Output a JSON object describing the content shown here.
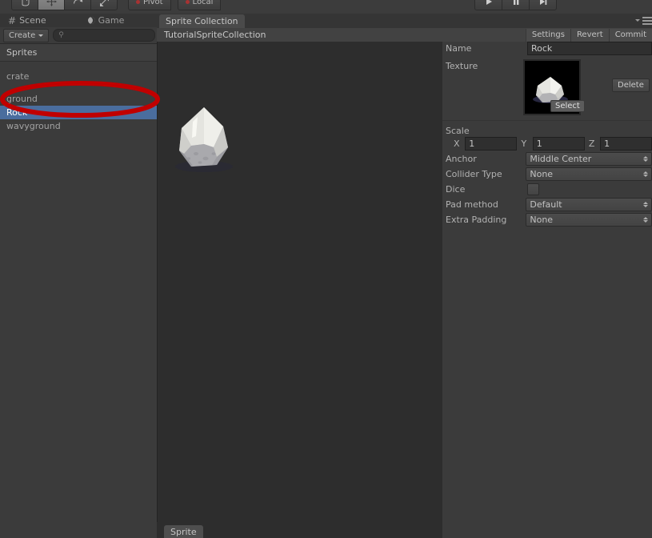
{
  "toolbar": {
    "tools": [
      {
        "name": "hand-tool",
        "active": false
      },
      {
        "name": "move-tool",
        "active": true
      },
      {
        "name": "rotate-tool",
        "active": false
      },
      {
        "name": "scale-tool",
        "active": false
      }
    ],
    "pivot_label": "Pivot",
    "local_label": "Local",
    "play_label": "play-icon",
    "pause_label": "pause-icon",
    "step_label": "step-icon"
  },
  "left_dock": {
    "tabs": [
      {
        "label": "Scene",
        "icon": "grid-icon"
      },
      {
        "label": "Game",
        "icon": "moon-icon"
      }
    ],
    "create_label": "Create",
    "search_value": "",
    "search_placeholder": "",
    "list_header": "Sprites",
    "items": [
      {
        "label": "crate",
        "selected": false
      },
      {
        "label": "ground",
        "selected": false
      },
      {
        "label": "Rock",
        "selected": true
      },
      {
        "label": "wavyground",
        "selected": false
      }
    ]
  },
  "center": {
    "tab_label": "Sprite Collection",
    "title": "TutorialSpriteCollection",
    "bottom_tab": "Sprite"
  },
  "inspector": {
    "menu_icon": "options-menu-icon",
    "actions": [
      "Settings",
      "Revert",
      "Commit"
    ],
    "name_label": "Name",
    "name_value": "Rock",
    "texture_label": "Texture",
    "select_label": "Select",
    "delete_label": "Delete",
    "scale_label": "Scale",
    "scale": {
      "x_label": "X",
      "x_value": "1",
      "y_label": "Y",
      "y_value": "1",
      "z_label": "Z",
      "z_value": "1"
    },
    "fields": [
      {
        "label": "Anchor",
        "value": "Middle Center",
        "type": "dropdown"
      },
      {
        "label": "Collider Type",
        "value": "None",
        "type": "dropdown"
      },
      {
        "label": "Dice",
        "value": "",
        "type": "checkbox"
      },
      {
        "label": "Pad method",
        "value": "Default",
        "type": "dropdown"
      },
      {
        "label": "Extra Padding",
        "value": "None",
        "type": "dropdown"
      }
    ]
  },
  "annotation": {
    "shape": "ellipse",
    "color": "#c00000",
    "target": "Rock"
  },
  "colors": {
    "selection_blue": "#4a6d9e",
    "panel_bg": "#3b3b3b",
    "canvas_bg": "#2d2d2d",
    "tabbar_bg": "#353535",
    "annotation_red": "#c00000"
  }
}
